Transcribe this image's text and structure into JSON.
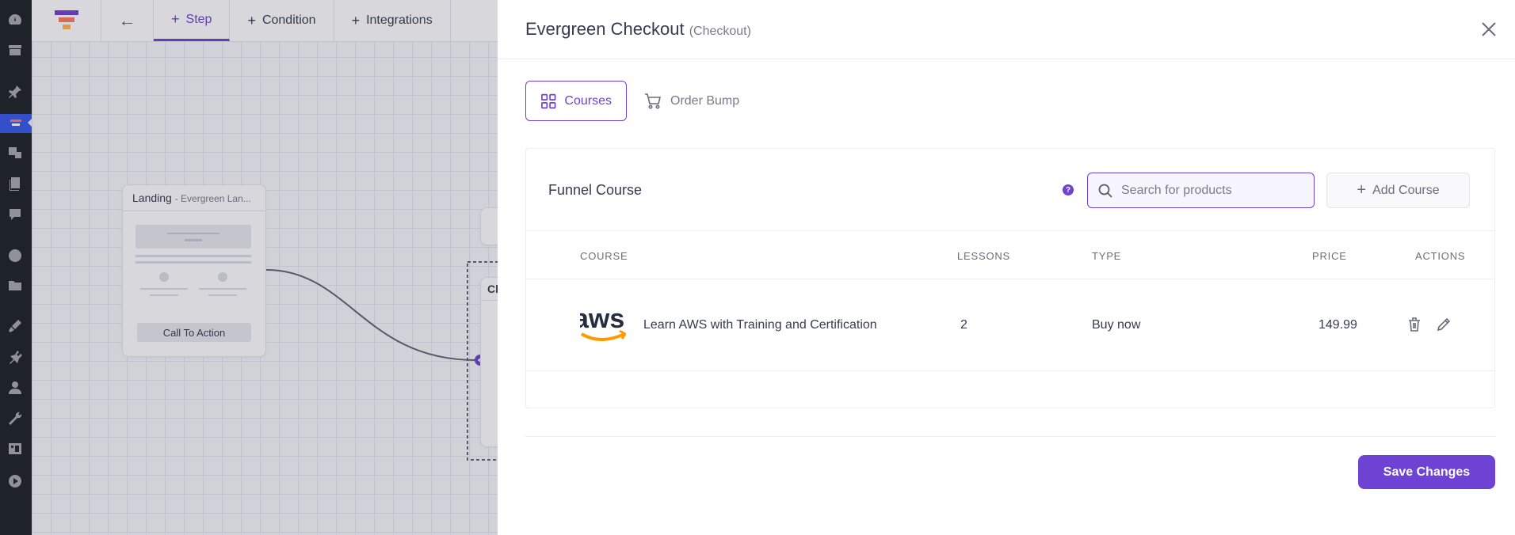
{
  "topbar": {
    "tabs": [
      {
        "label": "Step",
        "active": true
      },
      {
        "label": "Condition",
        "active": false
      },
      {
        "label": "Integrations",
        "active": false
      }
    ]
  },
  "canvas": {
    "landing_node": {
      "title": "Landing",
      "subtitle": "- Evergreen Lan...",
      "cta_label": "Call To Action"
    },
    "checkout_node": {
      "title_fragment": "Cl"
    }
  },
  "drawer": {
    "title": "Evergreen Checkout",
    "title_suffix": "(Checkout)",
    "tabs": [
      {
        "label": "Courses",
        "icon": "grid-icon",
        "active": true
      },
      {
        "label": "Order Bump",
        "icon": "cart-icon",
        "active": false
      }
    ],
    "section_title": "Funnel Course",
    "search": {
      "placeholder": "Search for products",
      "value": ""
    },
    "add_course_label": "Add Course",
    "table": {
      "headers": [
        "COURSE",
        "LESSONS",
        "TYPE",
        "PRICE",
        "ACTIONS"
      ],
      "rows": [
        {
          "course": "Learn AWS with Training and Certification",
          "thumb_text": "aws",
          "lessons": "2",
          "type": "Buy now",
          "price": "149.99"
        }
      ]
    },
    "save_label": "Save Changes"
  },
  "colors": {
    "accent": "#6e42d3",
    "sidebar": "#1d2327",
    "wp_active": "#3858e9",
    "aws_orange": "#ff9900"
  }
}
